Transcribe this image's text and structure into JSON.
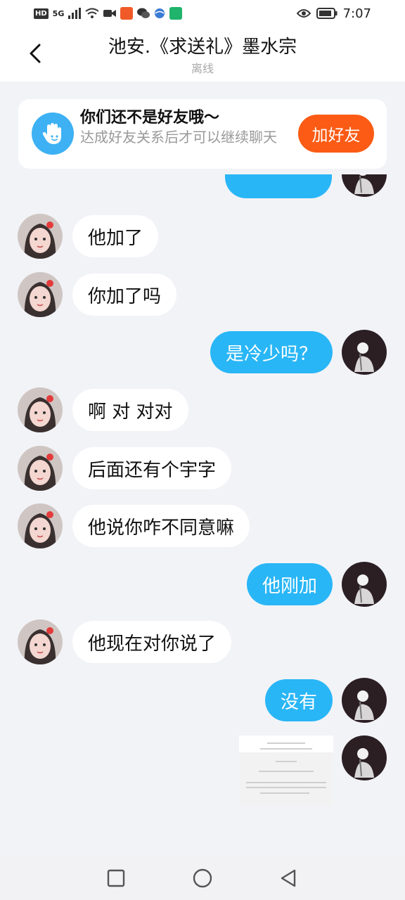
{
  "status_bar": {
    "time": "7:07",
    "hd_label": "HD",
    "network_label": "5G"
  },
  "header": {
    "title": "池安.《求送礼》墨水宗",
    "subtitle": "离线"
  },
  "notice": {
    "title": "你们还不是好友哦～",
    "description": "达成好友关系后才可以继续聊天",
    "button_label": "加好友"
  },
  "messages": [
    {
      "side": "left",
      "text": "他加了"
    },
    {
      "side": "left",
      "text": "你加了吗"
    },
    {
      "side": "right",
      "text": "是冷少吗？"
    },
    {
      "side": "left",
      "text": "啊 对 对对"
    },
    {
      "side": "left",
      "text": "后面还有个宇字"
    },
    {
      "side": "left",
      "text": "他说你咋不同意嘛"
    },
    {
      "side": "right",
      "text": "他刚加"
    },
    {
      "side": "left",
      "text": "他现在对你说了"
    },
    {
      "side": "right",
      "text": "没有"
    }
  ],
  "image_message": {
    "side": "right",
    "thumbnail": "screenshot-image"
  },
  "colors": {
    "accent_blue": "#29b6f6",
    "add_button_orange": "#fb5b14",
    "background": "#f2f3f7"
  },
  "icons": {
    "back": "chevron-left-icon",
    "notice": "hand-wave-icon",
    "nav_recent": "square-icon",
    "nav_home": "circle-icon",
    "nav_back": "triangle-back-icon"
  }
}
